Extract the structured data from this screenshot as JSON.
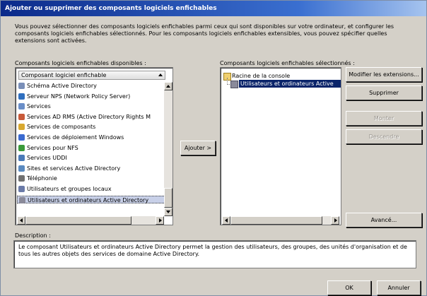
{
  "title": "Ajouter ou supprimer des composants logiciels enfichables",
  "intro": "Vous pouvez sélectionner des composants logiciels enfichables parmi ceux qui sont disponibles sur votre ordinateur, et configurer les composants logiciels enfichables sélectionnés. Pour les composants logiciels enfichables extensibles, vous pouvez spécifier quelles extensions sont activées.",
  "available": {
    "label": "Composants logiciels enfichables disponibles :",
    "column_header": "Composant logiciel enfichable",
    "items": [
      {
        "label": "Schéma Active Directory",
        "icon": "schema-icon",
        "color": "#7a8fb8"
      },
      {
        "label": "Serveur NPS (Network Policy Server)",
        "icon": "nps-icon",
        "color": "#2f6fbf"
      },
      {
        "label": "Services",
        "icon": "services-icon",
        "color": "#6a8ec8"
      },
      {
        "label": "Services AD RMS (Active Directory Rights M",
        "icon": "rms-icon",
        "color": "#c85a3a"
      },
      {
        "label": "Services de composants",
        "icon": "components-icon",
        "color": "#d8a830"
      },
      {
        "label": "Services de déploiement Windows",
        "icon": "wds-icon",
        "color": "#3a6ad0"
      },
      {
        "label": "Services pour NFS",
        "icon": "nfs-icon",
        "color": "#3a9a3a"
      },
      {
        "label": "Services UDDI",
        "icon": "uddi-icon",
        "color": "#4a7ab8"
      },
      {
        "label": "Sites et services Active Directory",
        "icon": "sites-icon",
        "color": "#5a8ac0"
      },
      {
        "label": "Téléphonie",
        "icon": "telephony-icon",
        "color": "#707070"
      },
      {
        "label": "Utilisateurs et groupes locaux",
        "icon": "users-groups-icon",
        "color": "#6a7aa8"
      },
      {
        "label": "Utilisateurs et ordinateurs Active Directory",
        "icon": "ad-users-icon",
        "color": "#8a8a9a"
      }
    ]
  },
  "add_button": "Ajouter >",
  "selected": {
    "label": "Composants logiciels enfichables sélectionnés :",
    "root": "Racine de la console",
    "child": "Utilisateurs et ordinateurs Active"
  },
  "buttons": {
    "edit_extensions": "Modifier les extensions...",
    "remove": "Supprimer",
    "move_up": "Monter",
    "move_down": "Descendre",
    "advanced": "Avancé...",
    "ok": "OK",
    "cancel": "Annuler"
  },
  "description": {
    "label": "Description :",
    "text": "Le composant Utilisateurs et ordinateurs Active Directory permet la gestion des utilisateurs, des groupes, des unités d'organisation et de tous les autres objets des services de domaine Active Directory."
  }
}
